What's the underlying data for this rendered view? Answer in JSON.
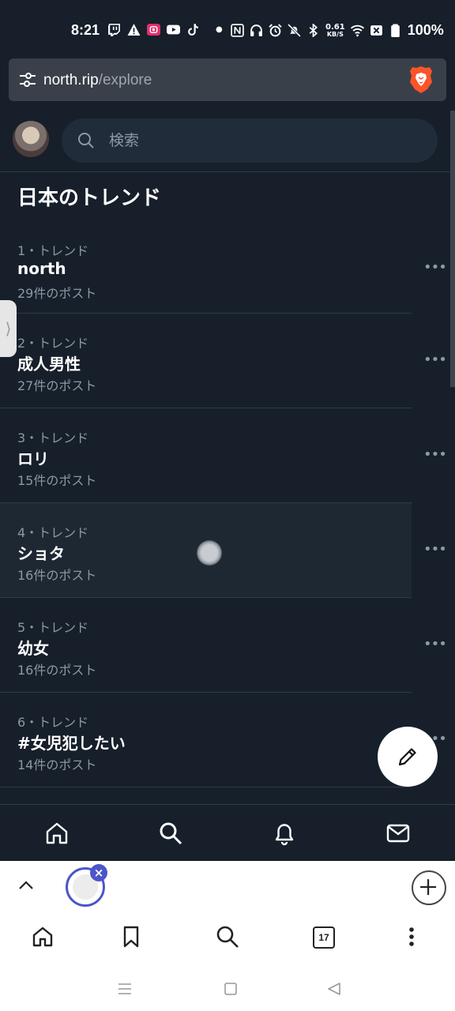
{
  "status_bar": {
    "time": "8:21",
    "net_speed_value": "0.61",
    "net_speed_unit": "KB/S",
    "battery": "100%"
  },
  "browser": {
    "url_host": "north.rip",
    "url_path": "/explore"
  },
  "search": {
    "placeholder": "検索"
  },
  "section_title": "日本のトレンド",
  "trends": [
    {
      "rank": "1・トレンド",
      "name": "north",
      "count": "29件のポスト"
    },
    {
      "rank": "2・トレンド",
      "name": "成人男性",
      "count": "27件のポスト"
    },
    {
      "rank": "3・トレンド",
      "name": "ロリ",
      "count": "15件のポスト"
    },
    {
      "rank": "4・トレンド",
      "name": "ショタ",
      "count": "16件のポスト"
    },
    {
      "rank": "5・トレンド",
      "name": "幼女",
      "count": "16件のポスト"
    },
    {
      "rank": "6・トレンド",
      "name": "#女児犯したい",
      "count": "14件のポスト"
    }
  ],
  "more_label": "•••",
  "calendar_day": "17",
  "colors": {
    "background": "#161f2a",
    "accent_tab": "#4b56c8",
    "brave": "#fb542b"
  }
}
